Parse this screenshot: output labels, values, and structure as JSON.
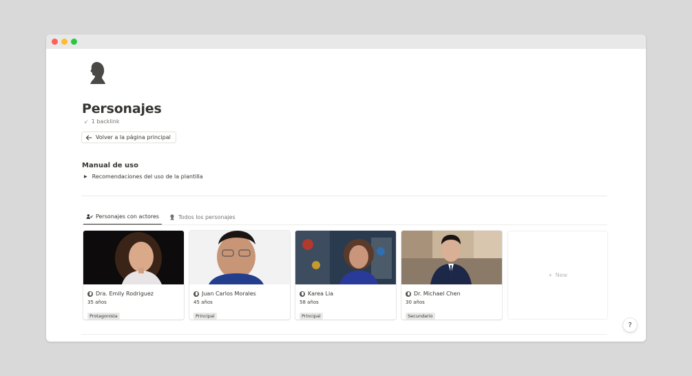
{
  "window": {
    "controls": [
      "close",
      "minimize",
      "maximize"
    ]
  },
  "page": {
    "icon": "bust-silhouette-icon",
    "title": "Personajes",
    "backlinks": "1 backlink",
    "back_button_label": "Volver a la página principal"
  },
  "manual": {
    "title": "Manual de uso",
    "toggle_label": "Recomendaciones del uso de la plantilla"
  },
  "tabs": [
    {
      "label": "Personajes con actores",
      "icon": "person-check-icon",
      "active": true
    },
    {
      "label": "Todos los personajes",
      "icon": "bust-icon",
      "active": false
    }
  ],
  "cards": [
    {
      "name": "Dra. Emily Rodriguez",
      "age": "35 años",
      "role": "Protagonista"
    },
    {
      "name": "Juan Carlos Morales",
      "age": "45 años",
      "role": "Principal"
    },
    {
      "name": "Karea Lia",
      "age": "58 años",
      "role": "Principal"
    },
    {
      "name": "Dr. Michael Chen",
      "age": "30 años",
      "role": "Secundario"
    }
  ],
  "new_card_label": "New",
  "help_label": "?",
  "colors": {
    "text": "#37352f",
    "muted": "#73726e",
    "tag_bg": "#e9e9e7",
    "window_bg": "#ffffff",
    "desktop_bg": "#d9d9d9"
  }
}
